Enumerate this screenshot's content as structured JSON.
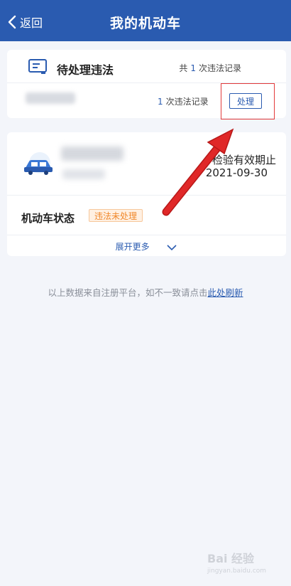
{
  "header": {
    "back_label": "返回",
    "title": "我的机动车"
  },
  "violations": {
    "title": "待处理违法",
    "total_prefix": "共",
    "total_count": "1",
    "total_suffix": "次违法记录",
    "item_count": "1",
    "item_suffix": "次违法记录",
    "handle_label": "处理"
  },
  "vehicle": {
    "valid_label": "检验有效期止",
    "valid_date": "2021-09-30",
    "status_label": "机动车状态",
    "status_badge": "违法未处理",
    "expand_label": "展开更多"
  },
  "footer": {
    "note_prefix": "以上数据来自注册平台，如不一致请点击",
    "refresh_link": "此处刷新"
  },
  "watermark": {
    "text": "Bai 经验",
    "sub": "jingyan.baidu.com"
  },
  "colors": {
    "header": "#2a5bb0",
    "accent": "#2a5bb0",
    "badge": "#f0882b",
    "annotation": "#e02828"
  }
}
